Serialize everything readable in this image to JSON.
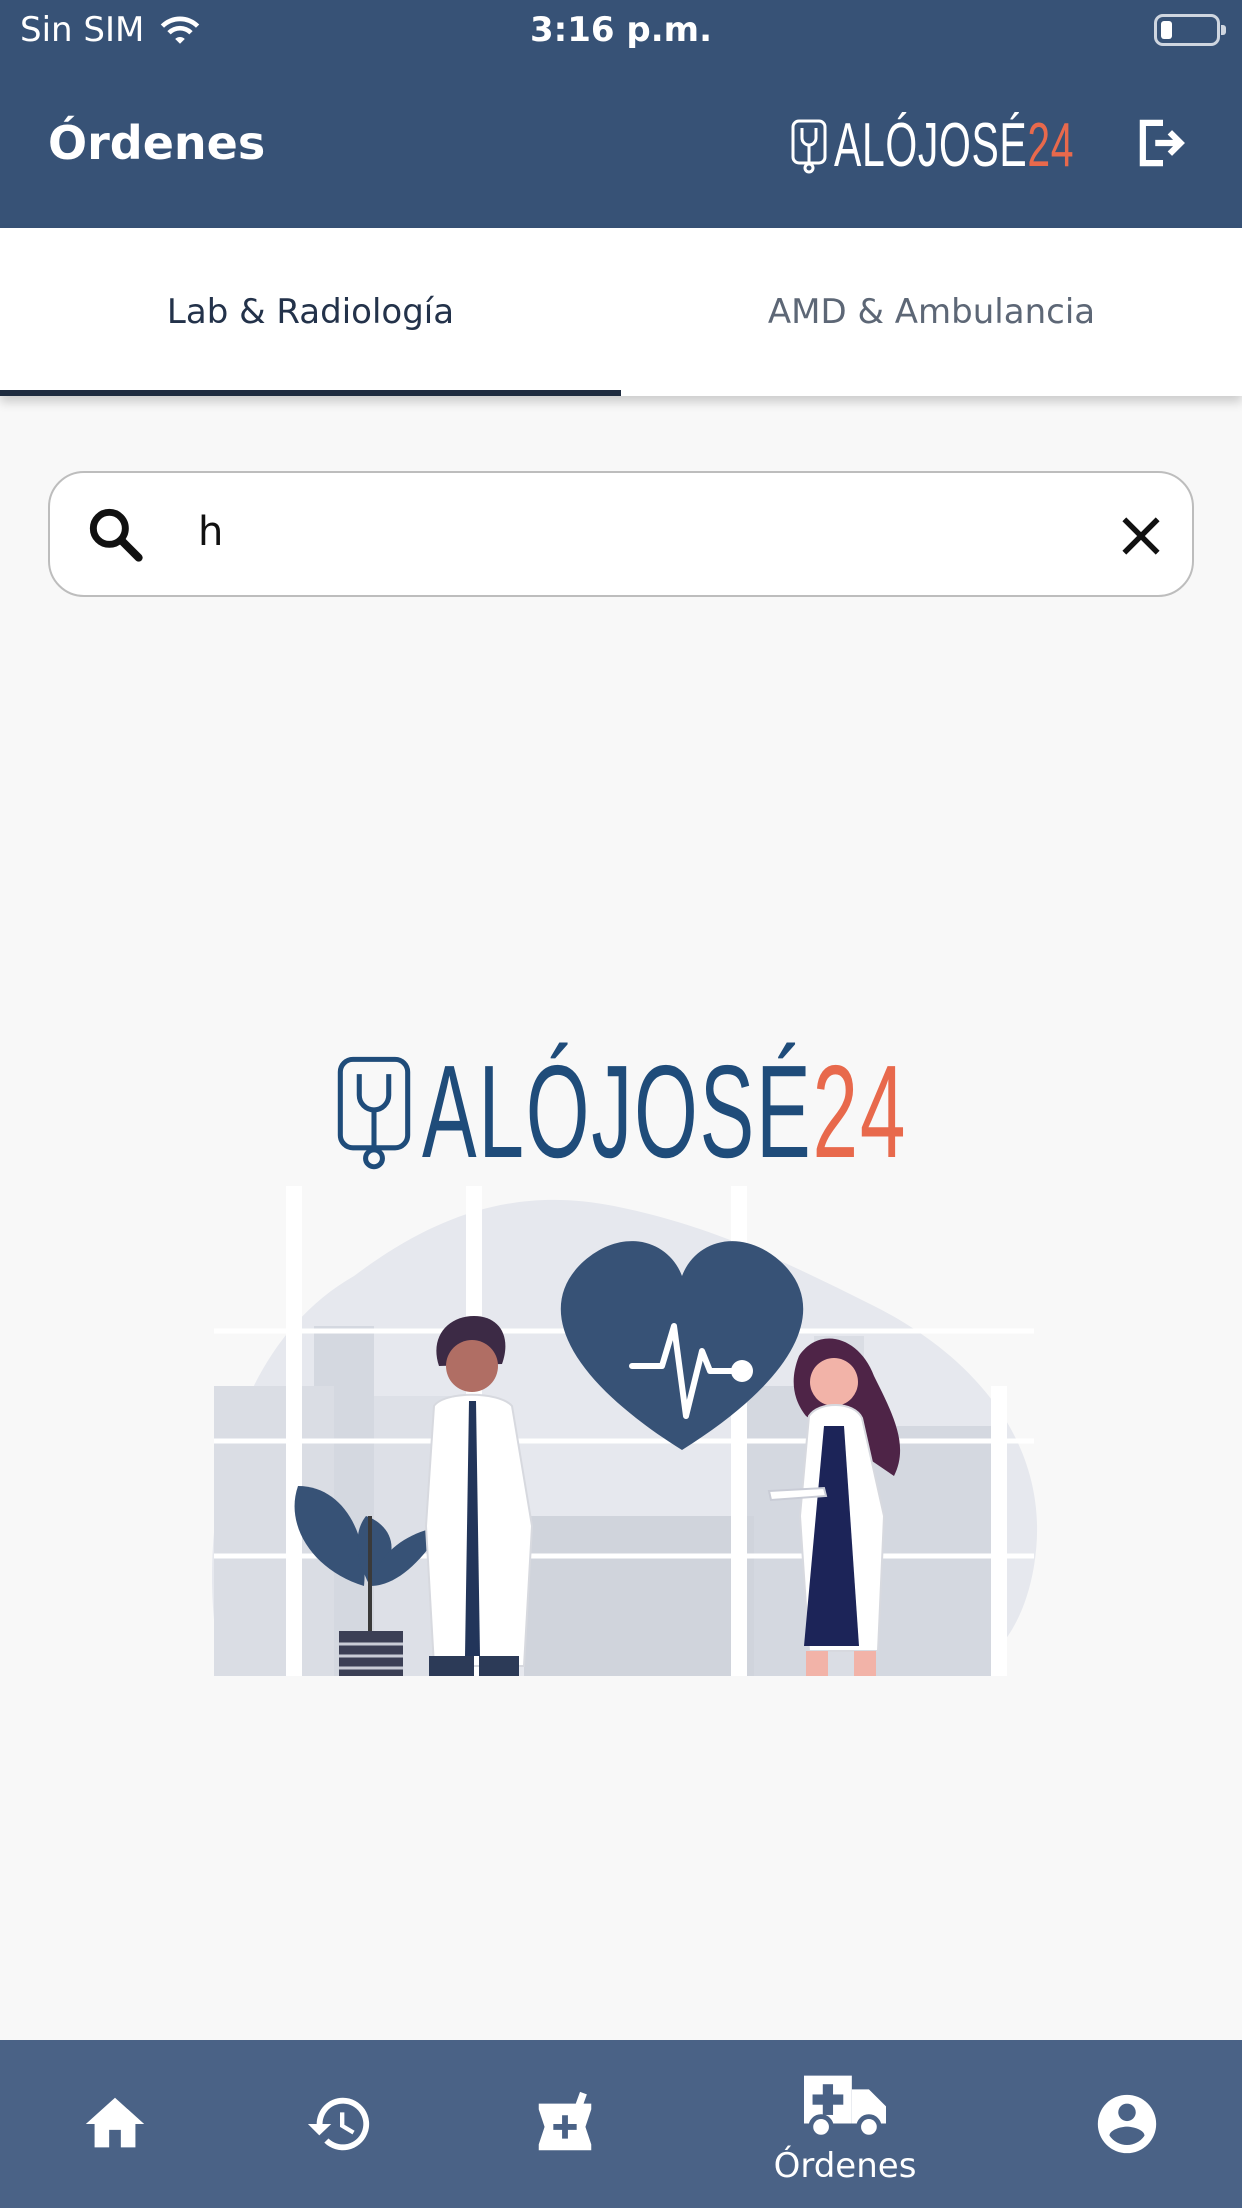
{
  "status_bar": {
    "carrier": "Sin SIM",
    "time": "3:16 p.m.",
    "wifi_icon": "wifi-icon",
    "battery_icon": "battery-low-icon"
  },
  "app_bar": {
    "title": "Órdenes",
    "logo_text_main": "ALÓJOSÉ",
    "logo_text_accent": "24",
    "logout_icon": "logout-icon"
  },
  "tabs": [
    {
      "label": "Lab & Radiología",
      "active": true
    },
    {
      "label": "AMD & Ambulancia",
      "active": false
    }
  ],
  "search": {
    "value": "h",
    "search_icon": "search-icon",
    "clear_icon": "close-icon"
  },
  "illustration": {
    "logo_text_main": "ALÓJOSÉ",
    "logo_text_accent": "24"
  },
  "bottom_nav": {
    "items": [
      {
        "icon": "home-icon",
        "label": ""
      },
      {
        "icon": "history-icon",
        "label": ""
      },
      {
        "icon": "pharmacy-icon",
        "label": ""
      },
      {
        "icon": "ambulance-icon",
        "label": "Órdenes",
        "active": true
      },
      {
        "icon": "account-icon",
        "label": ""
      }
    ]
  },
  "colors": {
    "primary": "#375276",
    "bottom_nav": "#4a6286",
    "accent": "#e8694c",
    "logo_blue": "#1f4c7a"
  }
}
